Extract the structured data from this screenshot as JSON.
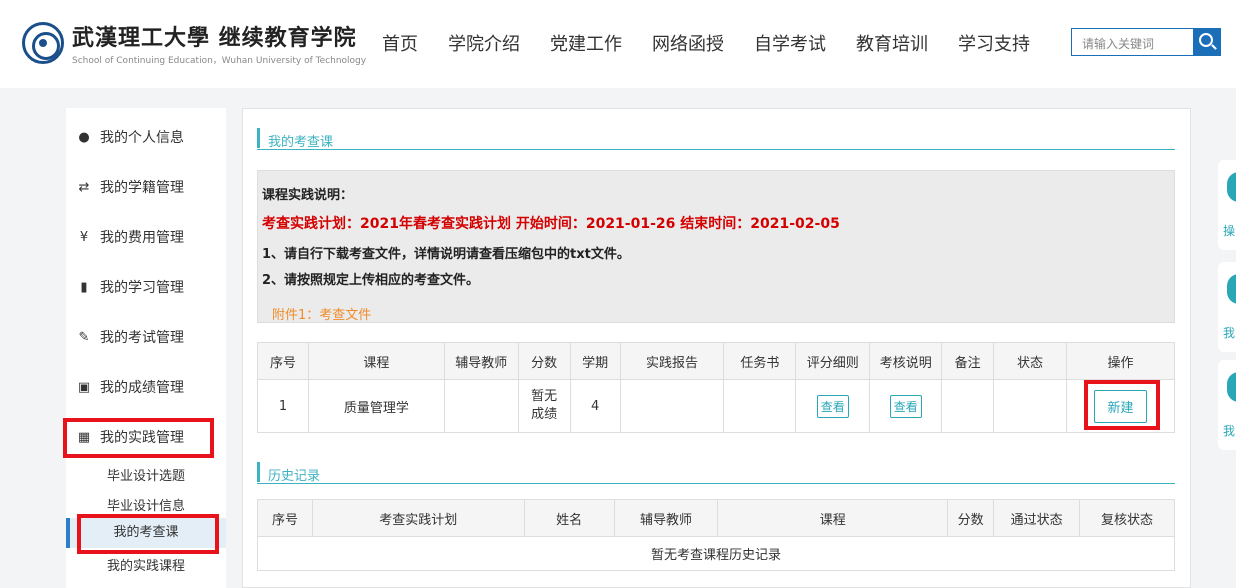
{
  "header": {
    "title_cn": "武漢理工大學 继续教育学院",
    "subtitle_en": "School of Continuing Education，Wuhan University of Technology",
    "nav": [
      "首页",
      "学院介绍",
      "党建工作",
      "网络函授",
      "自学考试",
      "教育培训",
      "学习支持"
    ],
    "search_placeholder": "请输入关键词"
  },
  "sidebar": {
    "items": [
      {
        "label": "我的个人信息",
        "icon": "user-icon"
      },
      {
        "label": "我的学籍管理",
        "icon": "retweet-icon"
      },
      {
        "label": "我的费用管理",
        "icon": "yen-icon"
      },
      {
        "label": "我的学习管理",
        "icon": "book-icon"
      },
      {
        "label": "我的考试管理",
        "icon": "edit-icon"
      },
      {
        "label": "我的成绩管理",
        "icon": "document-icon"
      },
      {
        "label": "我的实践管理",
        "icon": "id-card-icon"
      }
    ],
    "subitems": [
      "毕业设计选题",
      "毕业设计信息",
      "我的考查课",
      "我的实践课程"
    ]
  },
  "section1": {
    "title": "我的考查课"
  },
  "notice": {
    "heading": "课程实践说明：",
    "plan": "考查实践计划：2021年春考查实践计划  开始时间：2021-01-26  结束时间：2021-02-05",
    "line1": "1、请自行下载考查文件，详情说明请查看压缩包中的txt文件。",
    "line2": "2、请按照规定上传相应的考查文件。",
    "attachment": "附件1：考查文件"
  },
  "table1": {
    "headers": [
      "序号",
      "课程",
      "辅导教师",
      "分数",
      "学期",
      "实践报告",
      "任务书",
      "评分细则",
      "考核说明",
      "备注",
      "状态",
      "操作"
    ],
    "row": {
      "no": "1",
      "course": "质量管理学",
      "teacher": "",
      "score": "暂无\n成绩",
      "term": "4",
      "view1": "查看",
      "view2": "查看",
      "action": "新建"
    }
  },
  "section2": {
    "title": "历史记录"
  },
  "table2": {
    "headers": [
      "序号",
      "考查实践计划",
      "姓名",
      "辅导教师",
      "课程",
      "分数",
      "通过状态",
      "复核状态"
    ],
    "empty": "暂无考查课程历史记录"
  },
  "float_tabs": [
    "操",
    "我",
    "我"
  ],
  "colors": {
    "accent": "#3db3c2",
    "primary": "#1a6fb8",
    "alert": "#d40000",
    "highlight": "#e8121b"
  }
}
